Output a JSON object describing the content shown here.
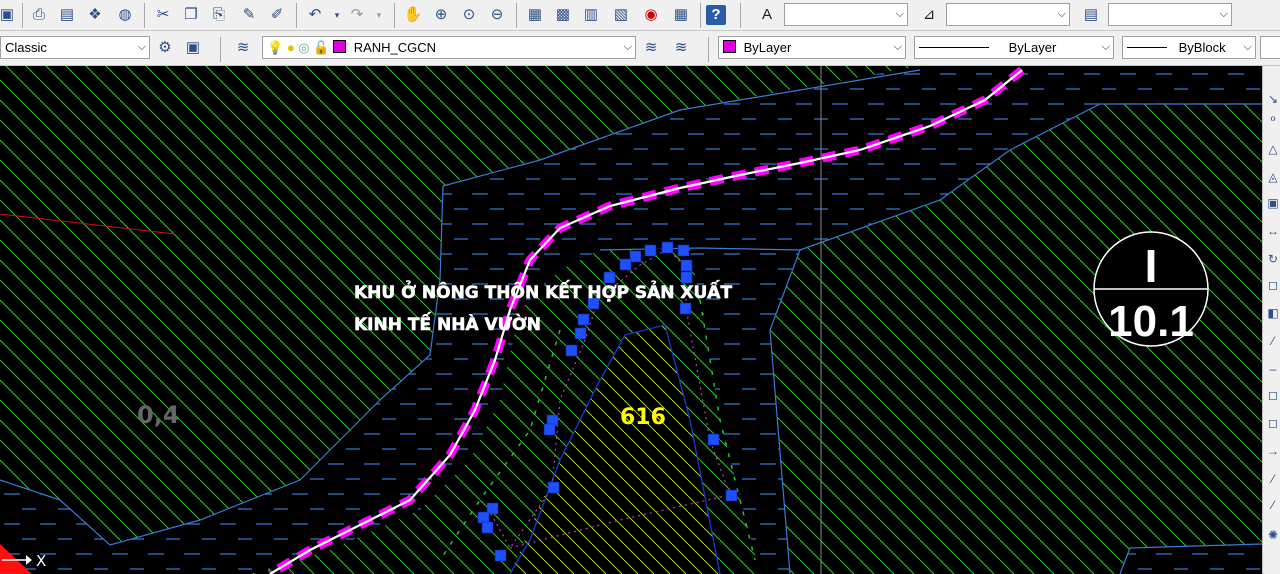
{
  "toolbar2": {
    "style_combo": "Classic",
    "layer_combo": "RANH_CGCN",
    "color_combo": "ByLayer",
    "linetype_combo": "ByLayer",
    "lineweight_combo": "ByBlock"
  },
  "drawing": {
    "label_area_line1": "KHU Ở NÔNG THÔN  KẾT HỢP SẢN XUẤT",
    "label_area_line2": "KINH TẾ NHÀ VƯỜN",
    "parcel_number": "616",
    "area_value": "0,4",
    "zone_roman": "I",
    "zone_number": "10.1",
    "ucs_axis_label": "X"
  },
  "colors": {
    "hatch": "#2fbf2f",
    "boundary": "#ff00ff",
    "grip": "#1e50ff",
    "water": "#3a7bd5",
    "parcel_label": "#ffff00",
    "background": "#000000"
  }
}
